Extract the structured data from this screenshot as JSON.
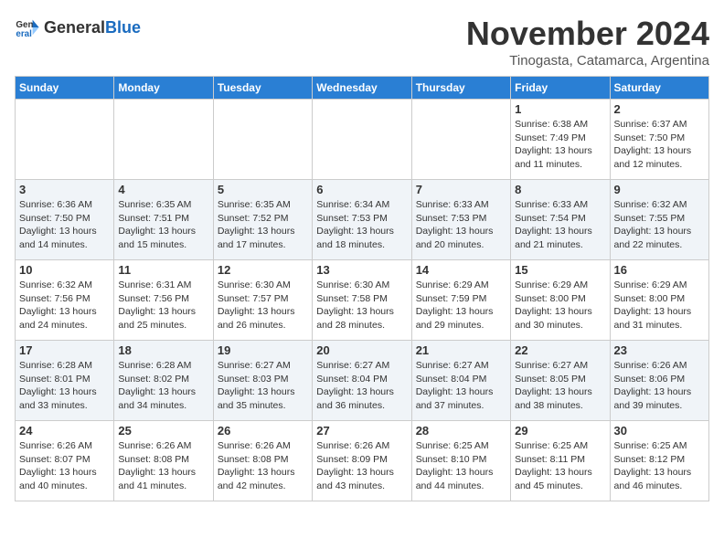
{
  "header": {
    "logo_general": "General",
    "logo_blue": "Blue",
    "month": "November 2024",
    "location": "Tinogasta, Catamarca, Argentina"
  },
  "weekdays": [
    "Sunday",
    "Monday",
    "Tuesday",
    "Wednesday",
    "Thursday",
    "Friday",
    "Saturday"
  ],
  "weeks": [
    {
      "cells": [
        {
          "day": "",
          "content": ""
        },
        {
          "day": "",
          "content": ""
        },
        {
          "day": "",
          "content": ""
        },
        {
          "day": "",
          "content": ""
        },
        {
          "day": "",
          "content": ""
        },
        {
          "day": "1",
          "content": "Sunrise: 6:38 AM\nSunset: 7:49 PM\nDaylight: 13 hours\nand 11 minutes."
        },
        {
          "day": "2",
          "content": "Sunrise: 6:37 AM\nSunset: 7:50 PM\nDaylight: 13 hours\nand 12 minutes."
        }
      ]
    },
    {
      "cells": [
        {
          "day": "3",
          "content": "Sunrise: 6:36 AM\nSunset: 7:50 PM\nDaylight: 13 hours\nand 14 minutes."
        },
        {
          "day": "4",
          "content": "Sunrise: 6:35 AM\nSunset: 7:51 PM\nDaylight: 13 hours\nand 15 minutes."
        },
        {
          "day": "5",
          "content": "Sunrise: 6:35 AM\nSunset: 7:52 PM\nDaylight: 13 hours\nand 17 minutes."
        },
        {
          "day": "6",
          "content": "Sunrise: 6:34 AM\nSunset: 7:53 PM\nDaylight: 13 hours\nand 18 minutes."
        },
        {
          "day": "7",
          "content": "Sunrise: 6:33 AM\nSunset: 7:53 PM\nDaylight: 13 hours\nand 20 minutes."
        },
        {
          "day": "8",
          "content": "Sunrise: 6:33 AM\nSunset: 7:54 PM\nDaylight: 13 hours\nand 21 minutes."
        },
        {
          "day": "9",
          "content": "Sunrise: 6:32 AM\nSunset: 7:55 PM\nDaylight: 13 hours\nand 22 minutes."
        }
      ]
    },
    {
      "cells": [
        {
          "day": "10",
          "content": "Sunrise: 6:32 AM\nSunset: 7:56 PM\nDaylight: 13 hours\nand 24 minutes."
        },
        {
          "day": "11",
          "content": "Sunrise: 6:31 AM\nSunset: 7:56 PM\nDaylight: 13 hours\nand 25 minutes."
        },
        {
          "day": "12",
          "content": "Sunrise: 6:30 AM\nSunset: 7:57 PM\nDaylight: 13 hours\nand 26 minutes."
        },
        {
          "day": "13",
          "content": "Sunrise: 6:30 AM\nSunset: 7:58 PM\nDaylight: 13 hours\nand 28 minutes."
        },
        {
          "day": "14",
          "content": "Sunrise: 6:29 AM\nSunset: 7:59 PM\nDaylight: 13 hours\nand 29 minutes."
        },
        {
          "day": "15",
          "content": "Sunrise: 6:29 AM\nSunset: 8:00 PM\nDaylight: 13 hours\nand 30 minutes."
        },
        {
          "day": "16",
          "content": "Sunrise: 6:29 AM\nSunset: 8:00 PM\nDaylight: 13 hours\nand 31 minutes."
        }
      ]
    },
    {
      "cells": [
        {
          "day": "17",
          "content": "Sunrise: 6:28 AM\nSunset: 8:01 PM\nDaylight: 13 hours\nand 33 minutes."
        },
        {
          "day": "18",
          "content": "Sunrise: 6:28 AM\nSunset: 8:02 PM\nDaylight: 13 hours\nand 34 minutes."
        },
        {
          "day": "19",
          "content": "Sunrise: 6:27 AM\nSunset: 8:03 PM\nDaylight: 13 hours\nand 35 minutes."
        },
        {
          "day": "20",
          "content": "Sunrise: 6:27 AM\nSunset: 8:04 PM\nDaylight: 13 hours\nand 36 minutes."
        },
        {
          "day": "21",
          "content": "Sunrise: 6:27 AM\nSunset: 8:04 PM\nDaylight: 13 hours\nand 37 minutes."
        },
        {
          "day": "22",
          "content": "Sunrise: 6:27 AM\nSunset: 8:05 PM\nDaylight: 13 hours\nand 38 minutes."
        },
        {
          "day": "23",
          "content": "Sunrise: 6:26 AM\nSunset: 8:06 PM\nDaylight: 13 hours\nand 39 minutes."
        }
      ]
    },
    {
      "cells": [
        {
          "day": "24",
          "content": "Sunrise: 6:26 AM\nSunset: 8:07 PM\nDaylight: 13 hours\nand 40 minutes."
        },
        {
          "day": "25",
          "content": "Sunrise: 6:26 AM\nSunset: 8:08 PM\nDaylight: 13 hours\nand 41 minutes."
        },
        {
          "day": "26",
          "content": "Sunrise: 6:26 AM\nSunset: 8:08 PM\nDaylight: 13 hours\nand 42 minutes."
        },
        {
          "day": "27",
          "content": "Sunrise: 6:26 AM\nSunset: 8:09 PM\nDaylight: 13 hours\nand 43 minutes."
        },
        {
          "day": "28",
          "content": "Sunrise: 6:25 AM\nSunset: 8:10 PM\nDaylight: 13 hours\nand 44 minutes."
        },
        {
          "day": "29",
          "content": "Sunrise: 6:25 AM\nSunset: 8:11 PM\nDaylight: 13 hours\nand 45 minutes."
        },
        {
          "day": "30",
          "content": "Sunrise: 6:25 AM\nSunset: 8:12 PM\nDaylight: 13 hours\nand 46 minutes."
        }
      ]
    }
  ]
}
